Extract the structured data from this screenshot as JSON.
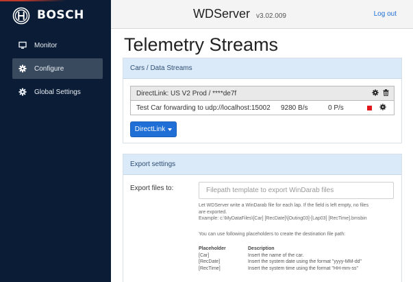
{
  "brand": {
    "name": "BOSCH"
  },
  "header": {
    "title": "WDServer",
    "version": "v3.02.009",
    "logout": "Log out"
  },
  "sidebar": {
    "items": [
      {
        "label": "Monitor",
        "icon": "monitor-icon",
        "active": false
      },
      {
        "label": "Configure",
        "icon": "gear-icon",
        "active": true
      },
      {
        "label": "Global Settings",
        "icon": "gear-icon",
        "active": false
      }
    ]
  },
  "page": {
    "title": "Telemetry Streams"
  },
  "streams_card": {
    "header": "Cars / Data Streams",
    "stream": {
      "name": "DirectLink: US V2 Prod / ****de7f",
      "row": {
        "label": "Test Car forwarding to udp://localhost:15002",
        "rate": "9280 B/s",
        "pps": "0 P/s"
      }
    },
    "directlink_button": "DirectLink"
  },
  "export_card": {
    "header": "Export settings",
    "label": "Export files to:",
    "placeholder": "Filepath template to export WinDarab files",
    "help_lines": [
      "Let WDServer write a WinDarab file for each lap. If the field is left empty, no files",
      "are exported.",
      "Example: c:\\MyDataFiles\\[Car] [RecDate]\\[Outing03]-[Lap03] [RecTime].bmsbin"
    ],
    "placeholder_intro": "You can use following placeholders to create the destination file path:",
    "table_headers": [
      "Placeholder",
      "Description"
    ],
    "table_rows": [
      [
        "[Car]",
        "Insert the name of the car."
      ],
      [
        "[RecDate]",
        "Insert the system date using the format \"yyyy-MM-dd\""
      ],
      [
        "[RecTime]",
        "Insert the system time using the format \"HH-mm-ss\""
      ]
    ]
  },
  "colors": {
    "sidebar": "#0b1d36",
    "accent": "#1f6fd6",
    "card_header": "#dbeaf8",
    "stop": "#e3161b"
  }
}
